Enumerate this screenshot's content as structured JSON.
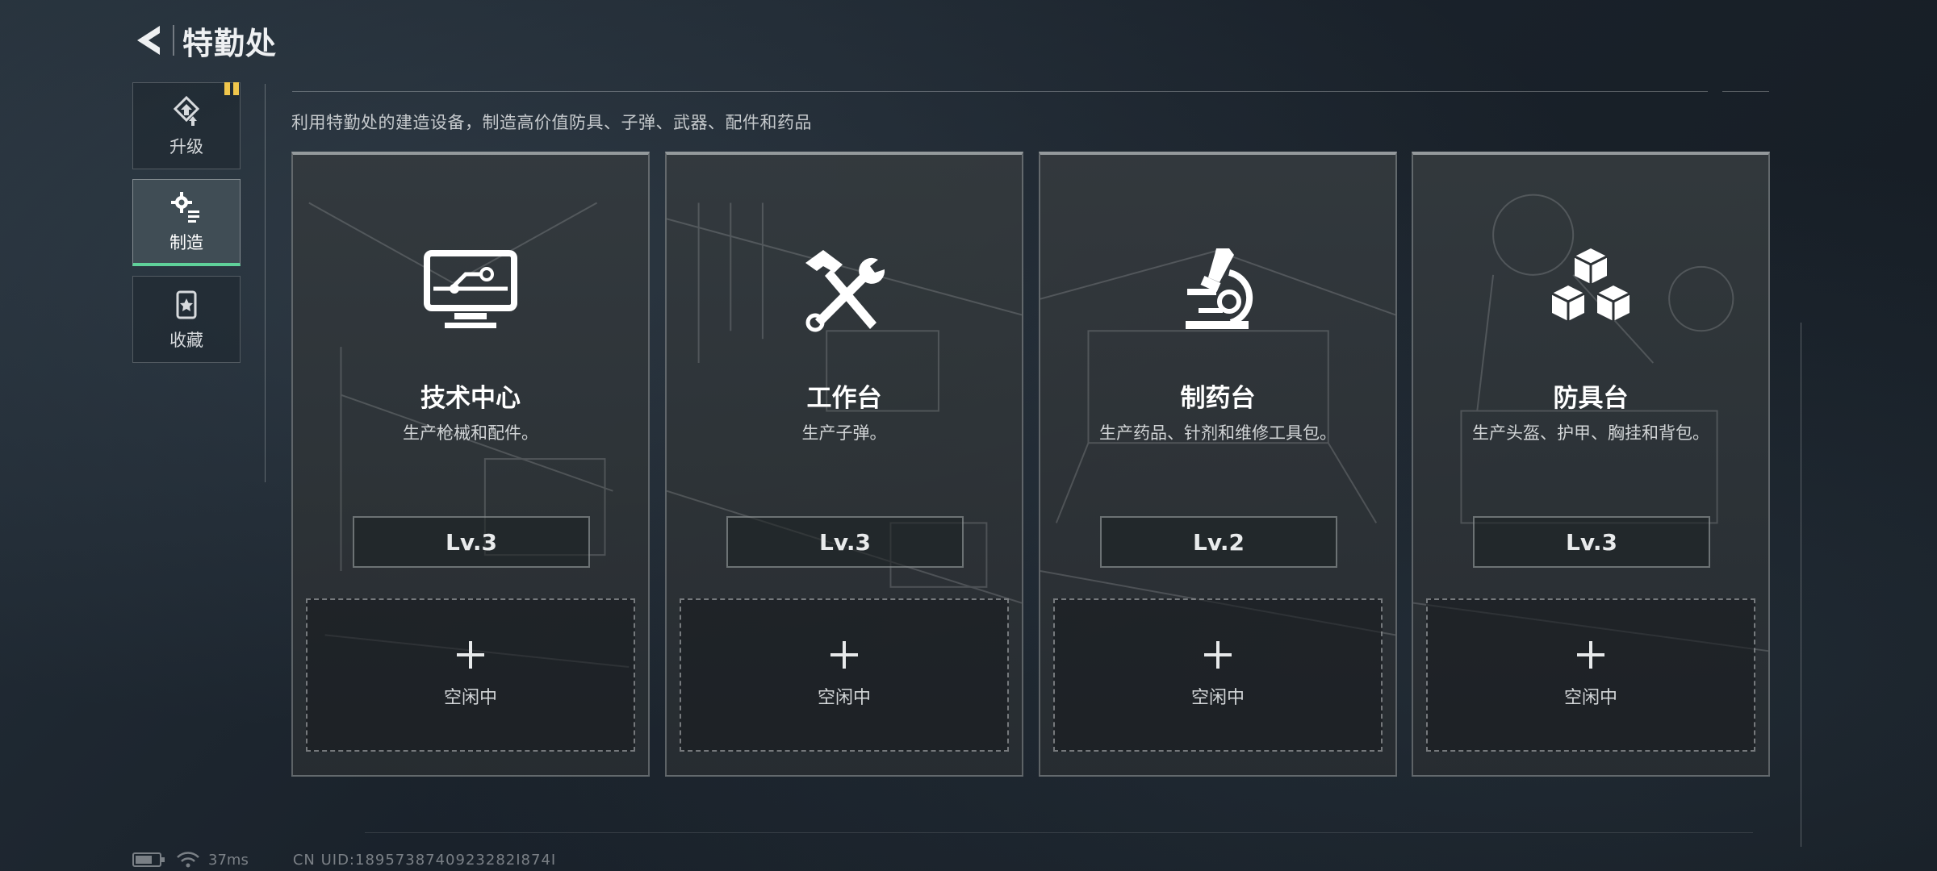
{
  "header": {
    "title": "特勤处"
  },
  "sidebar": {
    "items": [
      {
        "label": "升级",
        "icon": "upgrade-icon",
        "badge": true
      },
      {
        "label": "制造",
        "icon": "gear-icon",
        "active": true
      },
      {
        "label": "收藏",
        "icon": "collection-icon"
      }
    ]
  },
  "main": {
    "subtitle": "利用特勤处的建造设备，制造高价值防具、子弹、武器、配件和药品",
    "stations": [
      {
        "name": "技术中心",
        "desc": "生产枪械和配件。",
        "level": "Lv.3",
        "slot": "空闲中",
        "icon": "monitor-circuit-icon"
      },
      {
        "name": "工作台",
        "desc": "生产子弹。",
        "level": "Lv.3",
        "slot": "空闲中",
        "icon": "hammer-wrench-icon"
      },
      {
        "name": "制药台",
        "desc": "生产药品、针剂和维修工具包。",
        "level": "Lv.2",
        "slot": "空闲中",
        "icon": "microscope-icon"
      },
      {
        "name": "防具台",
        "desc": "生产头盔、护甲、胸挂和背包。",
        "level": "Lv.3",
        "slot": "空闲中",
        "icon": "cubes-icon"
      }
    ]
  },
  "status": {
    "ping": "37ms",
    "uid": "CN UID:1895738740923282I874I"
  },
  "colors": {
    "accent": "#5fd19a",
    "badge": "#f0c64c"
  }
}
